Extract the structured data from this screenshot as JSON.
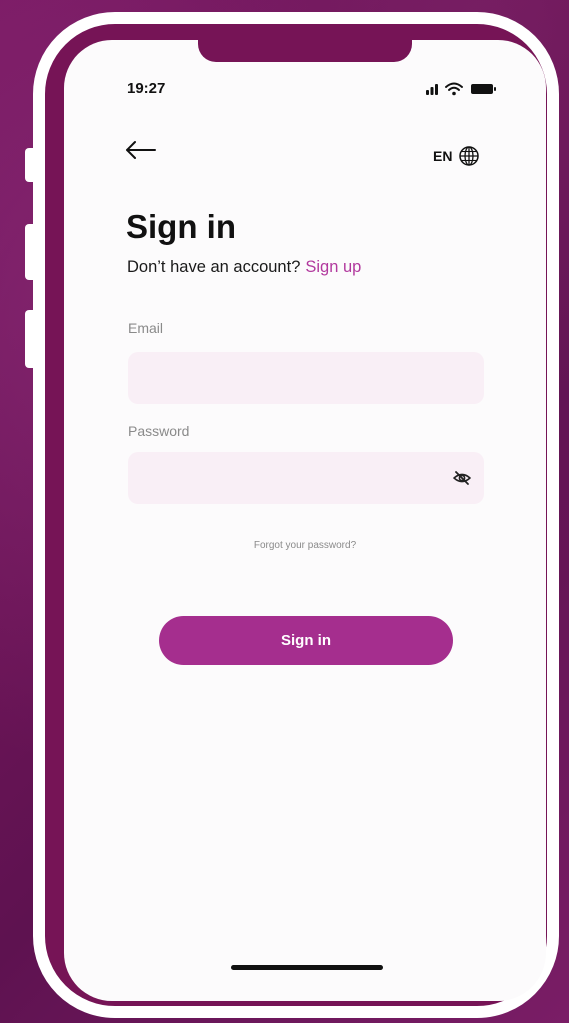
{
  "status_bar": {
    "time": "19:27",
    "icons": [
      "signal-icon",
      "wifi-icon",
      "battery-icon"
    ]
  },
  "header": {
    "back_icon": "arrow-left-icon",
    "language_code": "EN",
    "language_icon": "globe-icon"
  },
  "main": {
    "title": "Sign in",
    "no_account_text": "Don’t have an account?",
    "signup_link": "Sign up",
    "email": {
      "label": "Email",
      "value": "",
      "placeholder": ""
    },
    "password": {
      "label": "Password",
      "value": "",
      "placeholder": "",
      "toggle_icon": "eye-off-icon"
    },
    "forgot_link": "Forgot your password?",
    "submit_label": "Sign in"
  },
  "colors": {
    "brand": "#761456",
    "accent": "#a52e8e",
    "link": "#b2399e",
    "input_bg": "#f9eff6"
  }
}
